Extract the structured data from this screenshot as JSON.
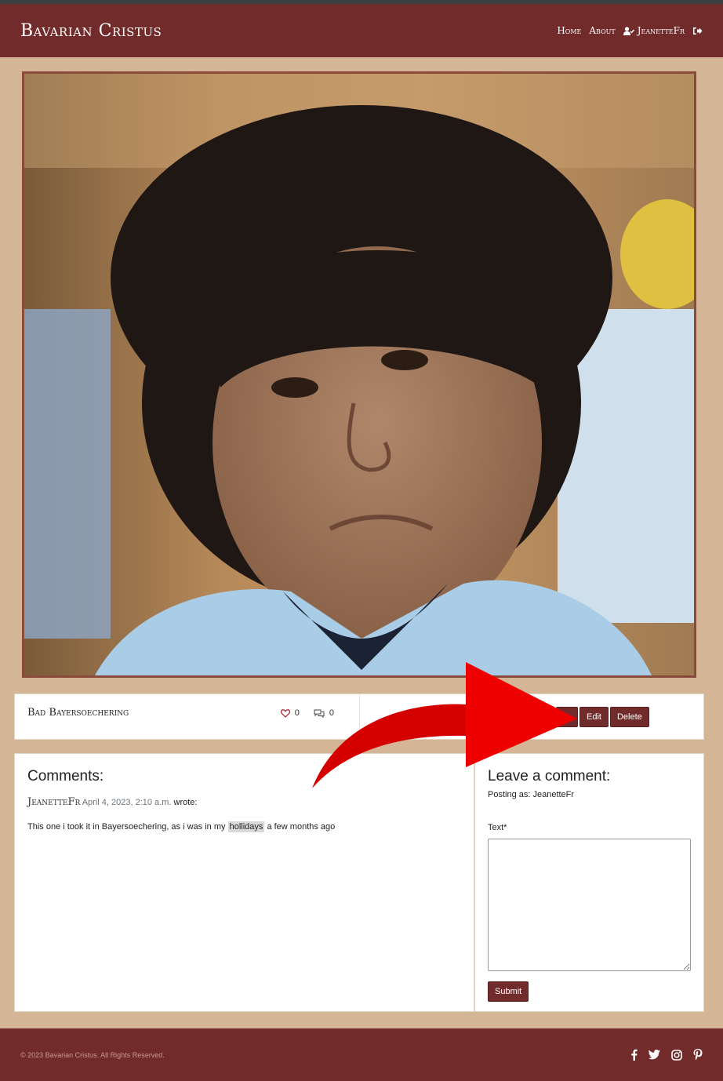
{
  "brand": "Bavarian Cristus",
  "nav": {
    "home": "Home",
    "about": "About",
    "user": "JeanetteFr"
  },
  "post": {
    "title": "Bad Bayersoechering",
    "likes": "0",
    "comments": "0",
    "edit_label": "Edit",
    "delete_label": "Delete"
  },
  "comments": {
    "heading": "Comments:",
    "items": [
      {
        "author": "JeanetteFr",
        "date": "April 4, 2023, 2:10 a.m.",
        "wrote": "wrote:",
        "text_before": "This one i took it in Bayersoechering, as i was in my",
        "text_highlight": "hollidays",
        "text_after": "a few months ago"
      }
    ]
  },
  "form": {
    "heading": "Leave a comment:",
    "posting_as": "Posting as: JeanetteFr",
    "text_label": "Text*",
    "text_value": "",
    "submit_label": "Submit"
  },
  "footer": {
    "copyright": "© 2023 Bavarian Cristus. All Rights Reserved."
  },
  "icons": {
    "user": "user-check-icon",
    "logout": "sign-out-icon",
    "like": "heart-icon",
    "comment": "comments-icon",
    "social": [
      "facebook-icon",
      "twitter-icon",
      "instagram-icon",
      "pinterest-icon"
    ]
  },
  "colors": {
    "brand": "#722b2b",
    "background": "#d4b596",
    "arrow": "#e00000"
  }
}
